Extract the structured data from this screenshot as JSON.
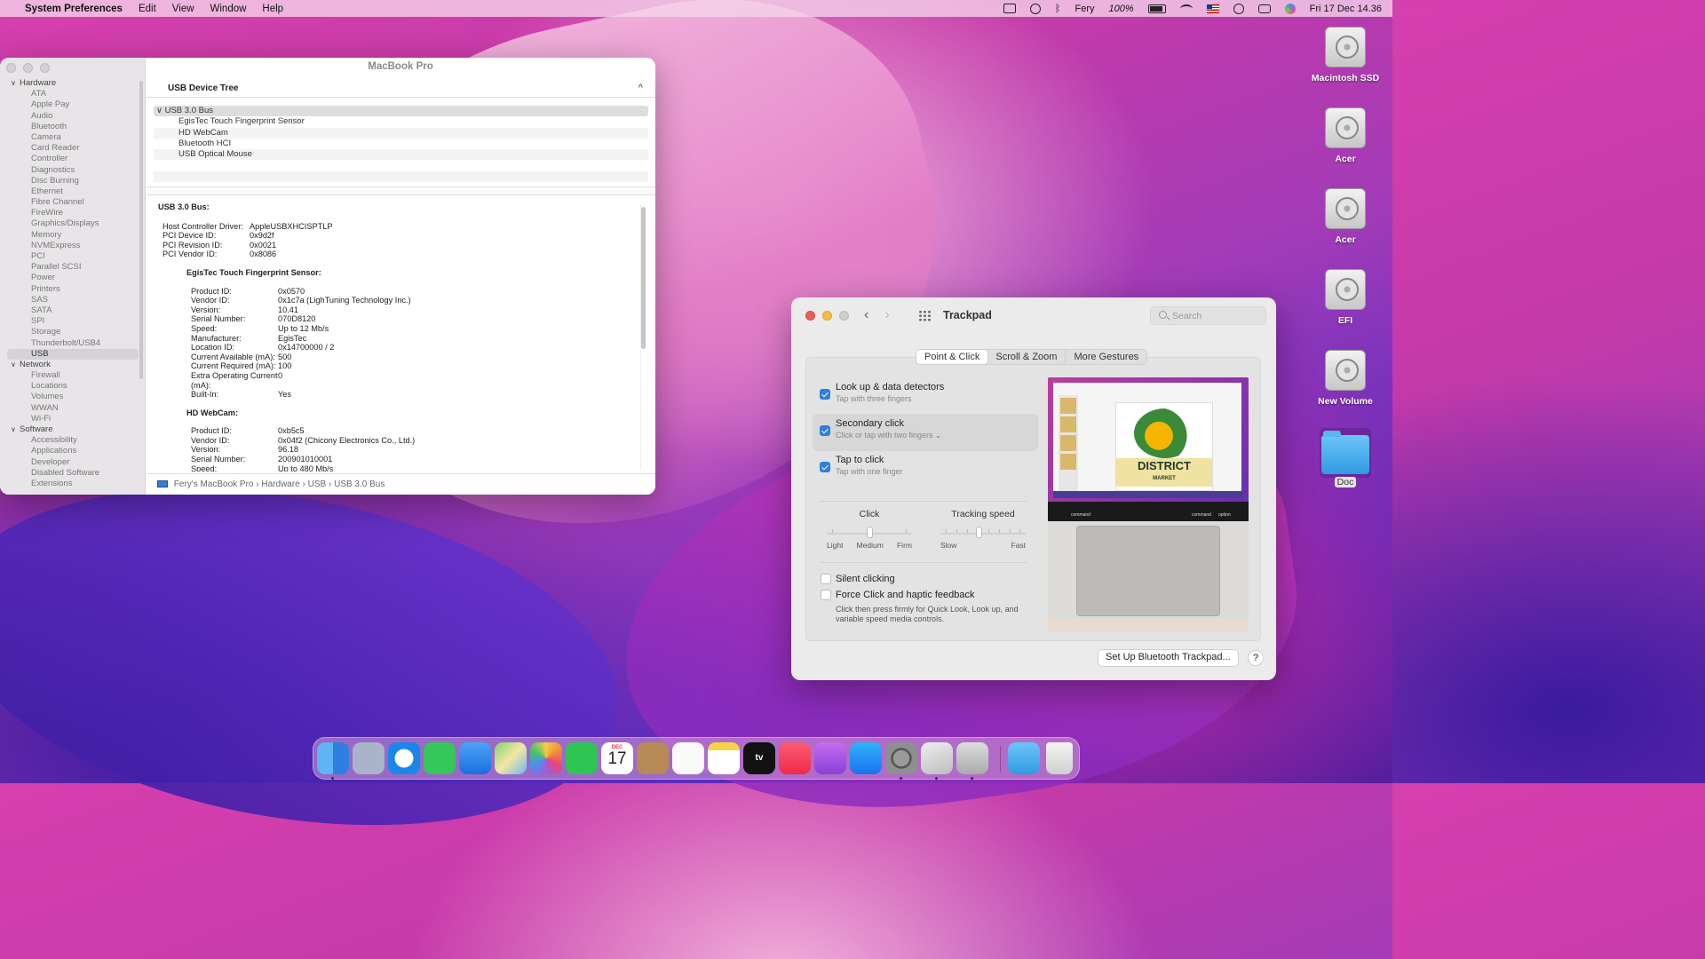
{
  "menubar": {
    "app": "System Preferences",
    "menus": [
      "Edit",
      "View",
      "Window",
      "Help"
    ],
    "user": "Fery",
    "battery": "100%",
    "datetime": "Fri 17 Dec  14.36"
  },
  "sysinfo": {
    "title": "MacBook Pro",
    "sidebar": {
      "hardware": "Hardware",
      "hardware_items": [
        "ATA",
        "Apple Pay",
        "Audio",
        "Bluetooth",
        "Camera",
        "Card Reader",
        "Controller",
        "Diagnostics",
        "Disc Burning",
        "Ethernet",
        "Fibre Channel",
        "FireWire",
        "Graphics/Displays",
        "Memory",
        "NVMExpress",
        "PCI",
        "Parallel SCSI",
        "Power",
        "Printers",
        "SAS",
        "SATA",
        "SPI",
        "Storage",
        "Thunderbolt/USB4",
        "USB"
      ],
      "network": "Network",
      "network_items": [
        "Firewall",
        "Locations",
        "Volumes",
        "WWAN",
        "Wi-Fi"
      ],
      "software": "Software",
      "software_items": [
        "Accessibility",
        "Applications",
        "Developer",
        "Disabled Software",
        "Extensions"
      ]
    },
    "column_header": "USB Device Tree",
    "tree": {
      "bus": "USB 3.0 Bus",
      "devices": [
        "EgisTec Touch Fingerprint Sensor",
        "HD WebCam",
        "Bluetooth HCI",
        "USB Optical Mouse"
      ]
    },
    "details": {
      "heading": "USB 3.0 Bus:",
      "bus_props": [
        {
          "k": "Host Controller Driver:",
          "v": "AppleUSBXHCISPTLP"
        },
        {
          "k": "PCI Device ID:",
          "v": "0x9d2f"
        },
        {
          "k": "PCI Revision ID:",
          "v": "0x0021"
        },
        {
          "k": "PCI Vendor ID:",
          "v": "0x8086"
        }
      ],
      "dev1_heading": "EgisTec Touch Fingerprint Sensor:",
      "dev1_props": [
        {
          "k": "Product ID:",
          "v": "0x0570"
        },
        {
          "k": "Vendor ID:",
          "v": "0x1c7a  (LighTuning Technology Inc.)"
        },
        {
          "k": "Version:",
          "v": "10.41"
        },
        {
          "k": "Serial Number:",
          "v": "070D8120"
        },
        {
          "k": "Speed:",
          "v": "Up to 12 Mb/s"
        },
        {
          "k": "Manufacturer:",
          "v": "EgisTec"
        },
        {
          "k": "Location ID:",
          "v": "0x14700000 / 2"
        },
        {
          "k": "Current Available (mA):",
          "v": "500"
        },
        {
          "k": "Current Required (mA):",
          "v": "100"
        },
        {
          "k": "Extra Operating Current (mA):",
          "v": "0"
        },
        {
          "k": "Built-In:",
          "v": "Yes"
        }
      ],
      "dev2_heading": "HD WebCam:",
      "dev2_props": [
        {
          "k": "Product ID:",
          "v": "0xb5c5"
        },
        {
          "k": "Vendor ID:",
          "v": "0x04f2  (Chicony Electronics Co., Ltd.)"
        },
        {
          "k": "Version:",
          "v": "96.18"
        },
        {
          "k": "Serial Number:",
          "v": "200901010001"
        },
        {
          "k": "Speed:",
          "v": "Up to 480 Mb/s"
        }
      ]
    },
    "breadcrumb": [
      "Fery's MacBook Pro",
      "Hardware",
      "USB",
      "USB 3.0 Bus"
    ]
  },
  "trackpad": {
    "title": "Trackpad",
    "search_placeholder": "Search",
    "tabs": [
      "Point & Click",
      "Scroll & Zoom",
      "More Gestures"
    ],
    "options": [
      {
        "label": "Look up & data detectors",
        "sub": "Tap with three fingers",
        "checked": true
      },
      {
        "label": "Secondary click",
        "sub": "Click or tap with two fingers",
        "checked": true
      },
      {
        "label": "Tap to click",
        "sub": "Tap with one finger",
        "checked": true
      }
    ],
    "click": {
      "label": "Click",
      "ends": [
        "Light",
        "Medium",
        "Firm"
      ],
      "value": "Medium"
    },
    "tracking": {
      "label": "Tracking speed",
      "ends": [
        "Slow",
        "Fast"
      ],
      "level": 0.45
    },
    "silent_clicking": "Silent clicking",
    "force_click": "Force Click and haptic feedback",
    "force_click_desc": "Click then press firmly for Quick Look, Look up, and variable speed media controls.",
    "preview_title": "DISTRICT",
    "preview_sub": "MARKET",
    "preview_keys": [
      "command",
      "command",
      "option"
    ],
    "setup_button": "Set Up Bluetooth Trackpad...",
    "help": "?"
  },
  "desktop": {
    "icons": [
      "Macintosh SSD",
      "Acer",
      "Acer",
      "EFI",
      "New Volume",
      "Doc"
    ]
  },
  "dock": {
    "calendar_month": "DEC",
    "calendar_day": "17",
    "tv_label": "tv"
  }
}
